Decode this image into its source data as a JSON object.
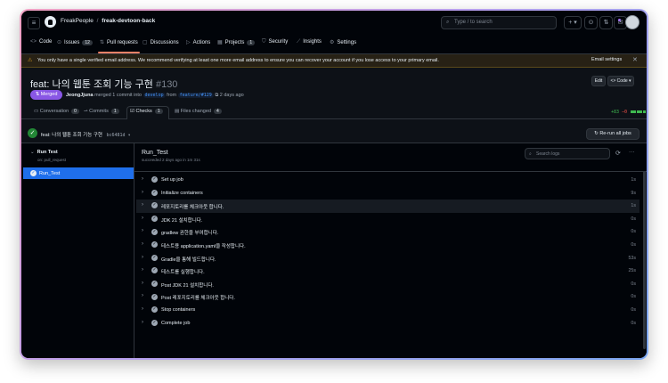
{
  "header": {
    "menu_icon": "hamburger-icon",
    "org": "FreakPeople",
    "separator": "/",
    "repo": "freak-devtoon-back",
    "search_placeholder": "Type / to search",
    "plus": "+ ▾"
  },
  "repo_nav": [
    {
      "icon": "<>",
      "label": "Code",
      "count": ""
    },
    {
      "icon": "⊙",
      "label": "Issues",
      "count": "12"
    },
    {
      "icon": "⇅",
      "label": "Pull requests",
      "count": ""
    },
    {
      "icon": "▢",
      "label": "Discussions",
      "count": ""
    },
    {
      "icon": "▷",
      "label": "Actions",
      "count": ""
    },
    {
      "icon": "▦",
      "label": "Projects",
      "count": "1"
    },
    {
      "icon": "⛉",
      "label": "Security",
      "count": ""
    },
    {
      "icon": "⟋",
      "label": "Insights",
      "count": ""
    },
    {
      "icon": "⚙",
      "label": "Settings",
      "count": ""
    }
  ],
  "banner": {
    "message": "You only have a single verified email address. We recommend verifying at least one more email address to ensure you can recover your account if you lose access to your primary email.",
    "settings_link": "Email settings",
    "close": "✕"
  },
  "pr": {
    "title": "feat: 나의 웹툰 조회 기능 구현",
    "number": "#130",
    "edit_label": "Edit",
    "code_label": "<> Code ▾",
    "state": "⇅ Merged",
    "author": "JeongJjuna",
    "meta_text": "merged 1 commit into",
    "base_branch": "develop",
    "from_text": "from",
    "head_branch": "feature/#129",
    "time": "2 days ago"
  },
  "pr_tabs": [
    {
      "label": "Conversation",
      "count": "0"
    },
    {
      "label": "Commits",
      "count": "1"
    },
    {
      "label": "Checks",
      "count": "1"
    },
    {
      "label": "Files changed",
      "count": "4"
    }
  ],
  "diffstat": {
    "add": "+83",
    "del": "−0"
  },
  "commit": {
    "message": "feat: 나의 웹툰 조회 기능 구현",
    "sha": "bc6481d ▾",
    "rerun_label": "↻ Re-run all jobs"
  },
  "workflow": {
    "name": "Run Test",
    "trigger": "on: pull_request",
    "job": "Run_Test"
  },
  "job_panel": {
    "title": "Run_Test",
    "subtitle": "succeeded 2 days ago in 1m 31s",
    "search_placeholder": "Search logs"
  },
  "steps": [
    {
      "name": "Set up job",
      "time": "1s"
    },
    {
      "name": "Initialize containers",
      "time": "9s"
    },
    {
      "name": "레포지토리를 체크아웃 합니다.",
      "time": "1s"
    },
    {
      "name": "JDK 21 설치합니다.",
      "time": "0s"
    },
    {
      "name": "gradlew 권한을 부여합니다.",
      "time": "0s"
    },
    {
      "name": "테스트용 application.yaml을 작성합니다.",
      "time": "0s"
    },
    {
      "name": "Gradle을 통해 빌드합니다.",
      "time": "53s"
    },
    {
      "name": "테스트를 실행합니다.",
      "time": "25s"
    },
    {
      "name": "Post JDK 21 설치합니다.",
      "time": "0s"
    },
    {
      "name": "Post 레포지토리를 체크아웃 합니다.",
      "time": "0s"
    },
    {
      "name": "Stop containers",
      "time": "0s"
    },
    {
      "name": "Complete job",
      "time": "0s"
    }
  ]
}
